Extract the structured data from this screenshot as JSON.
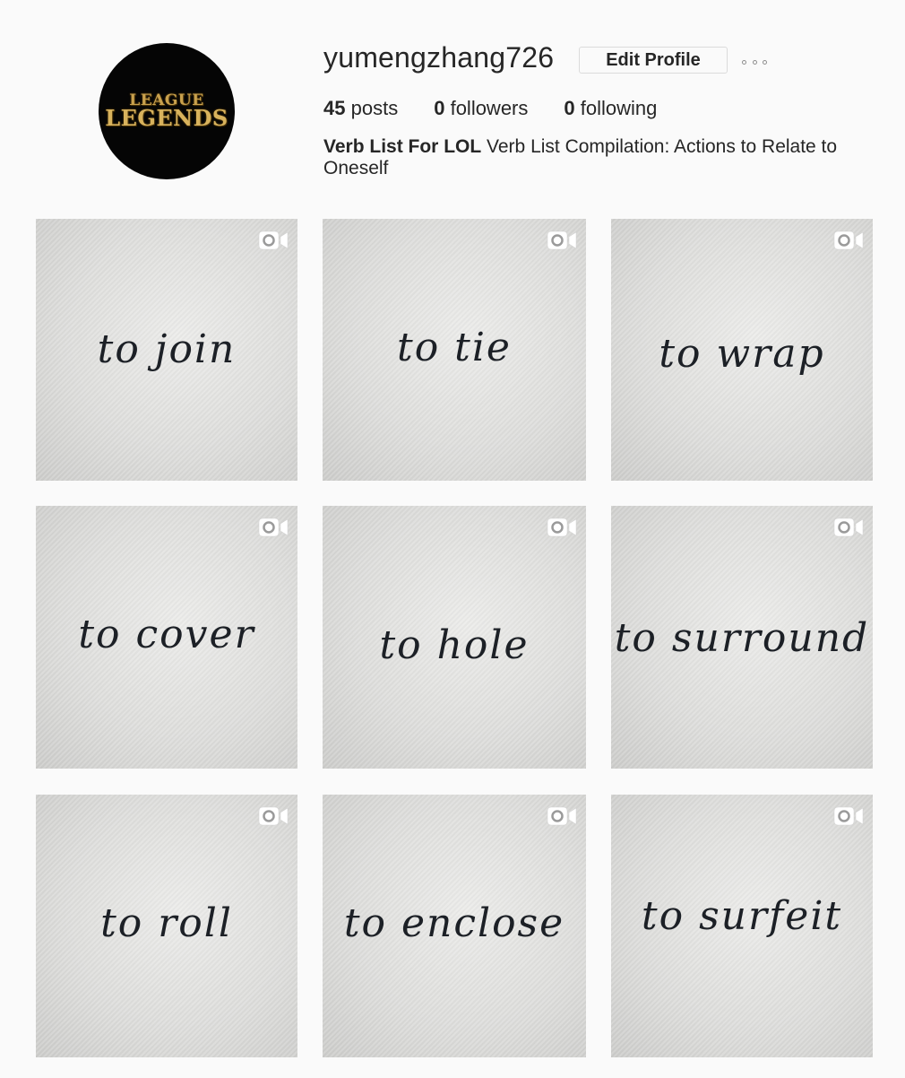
{
  "profile": {
    "username": "yumengzhang726",
    "edit_label": "Edit Profile",
    "avatar_logo_top": "LEAGUE",
    "avatar_logo_bottom": "LEGENDS",
    "stats": {
      "posts_count": "45",
      "posts_label": "posts",
      "followers_count": "0",
      "followers_label": "followers",
      "following_count": "0",
      "following_label": "following"
    },
    "bio_name": "Verb List For LOL",
    "bio_text": "Verb List Compilation: Actions to Relate to Oneself"
  },
  "posts": [
    {
      "text": "to join",
      "icon": "video-camera-icon"
    },
    {
      "text": "to tie",
      "icon": "video-camera-icon"
    },
    {
      "text": "to wrap",
      "icon": "video-camera-icon"
    },
    {
      "text": "to cover",
      "icon": "video-camera-icon"
    },
    {
      "text": "to hole",
      "icon": "video-camera-icon"
    },
    {
      "text": "to surround",
      "icon": "video-camera-icon"
    },
    {
      "text": "to roll",
      "icon": "video-camera-icon"
    },
    {
      "text": "to enclose",
      "icon": "video-camera-icon"
    },
    {
      "text": "to surfeit",
      "icon": "video-camera-icon"
    }
  ],
  "colors": {
    "page_bg": "#fafafa",
    "text": "#262626",
    "button_border": "#dbdbdb",
    "logo_gold": "#c9a14d",
    "post_text": "#1c2026"
  }
}
